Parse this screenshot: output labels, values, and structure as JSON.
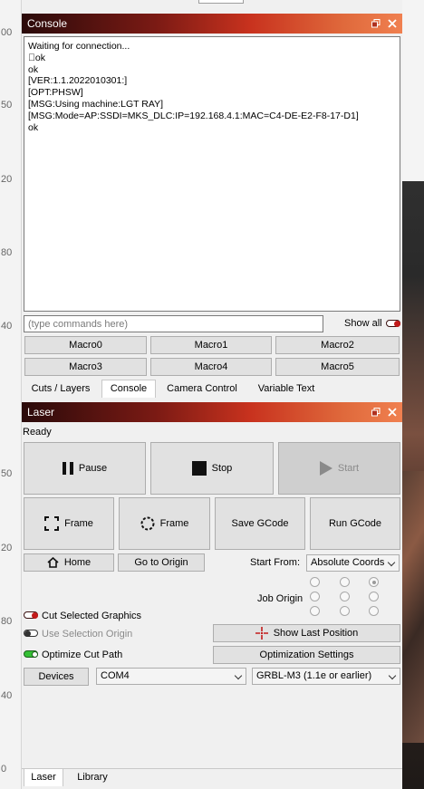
{
  "ruler": {
    "labels": [
      "00",
      "50",
      "20",
      "80",
      "40",
      "50",
      "20",
      "80",
      "40",
      "0"
    ]
  },
  "console_panel": {
    "title": "Console",
    "output_lines": [
      "Waiting for connection...",
      "\u0000ok",
      "ok",
      "[VER:1.1.2022010301:]",
      "[OPT:PHSW]",
      "[MSG:Using machine:LGT RAY]",
      "[MSG:Mode=AP:SSDI=MKS_DLC:IP=192.168.4.1:MAC=C4-DE-E2-F8-17-D1]",
      "ok"
    ],
    "command_placeholder": "(type commands here)",
    "show_all_label": "Show all",
    "macros": [
      "Macro0",
      "Macro1",
      "Macro2",
      "Macro3",
      "Macro4",
      "Macro5"
    ]
  },
  "upper_tabs": [
    "Cuts / Layers",
    "Console",
    "Camera Control",
    "Variable Text"
  ],
  "upper_tabs_active": "Console",
  "laser_panel": {
    "title": "Laser",
    "status": "Ready",
    "pause_label": "Pause",
    "stop_label": "Stop",
    "start_label": "Start",
    "frame_rect_label": "Frame",
    "frame_circle_label": "Frame",
    "save_gcode_label": "Save GCode",
    "run_gcode_label": "Run GCode",
    "home_label": "Home",
    "go_to_origin_label": "Go to Origin",
    "start_from_label": "Start From:",
    "start_from_value": "Absolute Coords",
    "job_origin_label": "Job Origin",
    "cut_selected_label": "Cut Selected Graphics",
    "use_selection_origin_label": "Use Selection Origin",
    "optimize_cut_path_label": "Optimize Cut Path",
    "show_last_position_label": "Show Last Position",
    "optimization_settings_label": "Optimization Settings",
    "devices_label": "Devices",
    "port_value": "COM4",
    "device_value": "GRBL-M3 (1.1e or earlier)"
  },
  "bottom_tabs": [
    "Laser",
    "Library"
  ],
  "bottom_tabs_active": "Laser",
  "colors": {
    "title_gradient_start": "#2a0a0a",
    "title_gradient_end": "#f08050",
    "toggle_red": "#c21a1a",
    "toggle_green": "#34c034"
  }
}
